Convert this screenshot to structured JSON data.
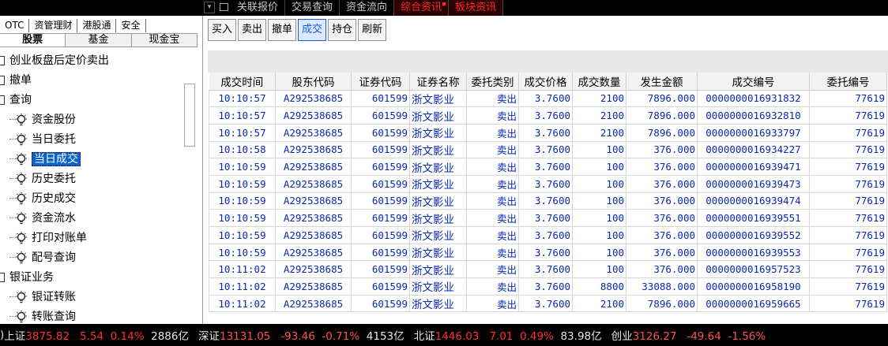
{
  "top_tabs": [
    {
      "label": "关联报价",
      "highlight": false
    },
    {
      "label": "交易查询",
      "highlight": false
    },
    {
      "label": "资金流向",
      "highlight": false
    },
    {
      "label": "综合资讯",
      "highlight": true
    },
    {
      "label": "板块资讯",
      "highlight": true
    }
  ],
  "left": {
    "tabs_row1": [
      "OTC",
      "资管理财",
      "港股通",
      "安全"
    ],
    "tabs_row2": [
      "股票",
      "基金",
      "现金宝"
    ],
    "active_tab": "股票",
    "tree": [
      {
        "label": "创业板盘后定价卖出",
        "level": 1
      },
      {
        "label": "撤单",
        "level": 1
      },
      {
        "label": "查询",
        "level": 1
      },
      {
        "label": "资金股份",
        "level": 2
      },
      {
        "label": "当日委托",
        "level": 2
      },
      {
        "label": "当日成交",
        "level": 2,
        "selected": true
      },
      {
        "label": "历史委托",
        "level": 2
      },
      {
        "label": "历史成交",
        "level": 2
      },
      {
        "label": "资金流水",
        "level": 2
      },
      {
        "label": "打印对账单",
        "level": 2
      },
      {
        "label": "配号查询",
        "level": 2
      },
      {
        "label": "银证业务",
        "level": 1
      },
      {
        "label": "银证转账",
        "level": 2
      },
      {
        "label": "转账查询",
        "level": 2
      }
    ]
  },
  "toolbar": [
    "买入",
    "卖出",
    "撤单",
    "成交",
    "持仓",
    "刷新"
  ],
  "toolbar_active": "成交",
  "table": {
    "headers": [
      "成交时间",
      "股东代码",
      "证券代码",
      "证券名称",
      "委托类别",
      "成交价格",
      "成交数量",
      "发生金额",
      "成交编号",
      "委托编号"
    ],
    "rows": [
      [
        "10:10:57",
        "A292538685",
        "601599",
        "浙文影业",
        "卖出",
        "3.7600",
        "2100",
        "7896.000",
        "0000000016931832",
        "77619"
      ],
      [
        "10:10:57",
        "A292538685",
        "601599",
        "浙文影业",
        "卖出",
        "3.7600",
        "2100",
        "7896.000",
        "0000000016932810",
        "77619"
      ],
      [
        "10:10:57",
        "A292538685",
        "601599",
        "浙文影业",
        "卖出",
        "3.7600",
        "2100",
        "7896.000",
        "0000000016933797",
        "77619"
      ],
      [
        "10:10:58",
        "A292538685",
        "601599",
        "浙文影业",
        "卖出",
        "3.7600",
        "100",
        "376.000",
        "0000000016934227",
        "77619"
      ],
      [
        "10:10:59",
        "A292538685",
        "601599",
        "浙文影业",
        "卖出",
        "3.7600",
        "100",
        "376.000",
        "0000000016939471",
        "77619"
      ],
      [
        "10:10:59",
        "A292538685",
        "601599",
        "浙文影业",
        "卖出",
        "3.7600",
        "100",
        "376.000",
        "0000000016939473",
        "77619"
      ],
      [
        "10:10:59",
        "A292538685",
        "601599",
        "浙文影业",
        "卖出",
        "3.7600",
        "100",
        "376.000",
        "0000000016939474",
        "77619"
      ],
      [
        "10:10:59",
        "A292538685",
        "601599",
        "浙文影业",
        "卖出",
        "3.7600",
        "100",
        "376.000",
        "0000000016939551",
        "77619"
      ],
      [
        "10:10:59",
        "A292538685",
        "601599",
        "浙文影业",
        "卖出",
        "3.7600",
        "100",
        "376.000",
        "0000000016939552",
        "77619"
      ],
      [
        "10:10:59",
        "A292538685",
        "601599",
        "浙文影业",
        "卖出",
        "3.7600",
        "100",
        "376.000",
        "0000000016939553",
        "77619"
      ],
      [
        "10:11:02",
        "A292538685",
        "601599",
        "浙文影业",
        "卖出",
        "3.7600",
        "100",
        "376.000",
        "0000000016957523",
        "77619"
      ],
      [
        "10:11:02",
        "A292538685",
        "601599",
        "浙文影业",
        "卖出",
        "3.7600",
        "8800",
        "33088.000",
        "0000000016958190",
        "77619"
      ],
      [
        "10:11:02",
        "A292538685",
        "601599",
        "浙文影业",
        "卖出",
        "3.7600",
        "2100",
        "7896.000",
        "0000000016959665",
        "77619"
      ]
    ]
  },
  "status_bar": {
    "sh": {
      "name": "上证",
      "index": "3875.82",
      "change": "5.54",
      "pct": "0.14%",
      "vol": "2886亿"
    },
    "sz": {
      "name": "深证",
      "index": "13131.05",
      "change": "-93.46",
      "pct": "-0.71%",
      "vol": "4153亿"
    },
    "bj": {
      "name": "北证",
      "index": "1446.03",
      "change": "7.01",
      "pct": "0.49%",
      "vol": "83.98亿"
    },
    "cy": {
      "name": "创业",
      "index": "3126.27",
      "change": "-49.64",
      "pct": "-1.56%"
    }
  }
}
